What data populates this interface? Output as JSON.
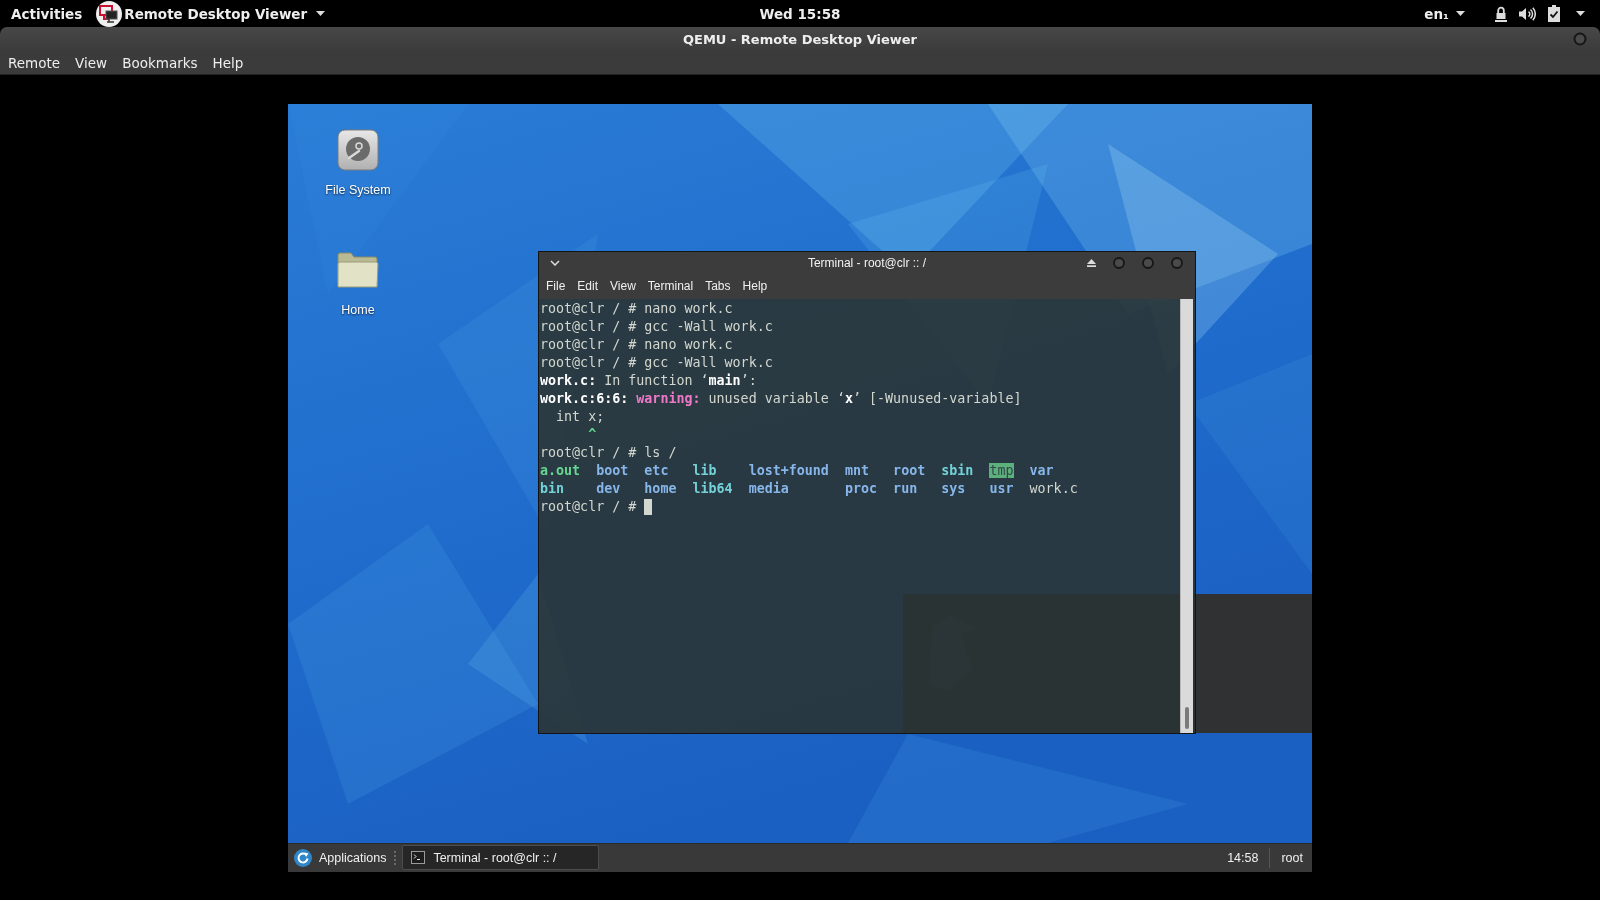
{
  "top_bar": {
    "activities": "Activities",
    "app_menu": "Remote Desktop Viewer",
    "clock": "Wed 15:58",
    "keyboard_layout": "en₁"
  },
  "window": {
    "title": "QEMU - Remote Desktop Viewer",
    "menu": [
      "Remote",
      "View",
      "Bookmarks",
      "Help"
    ]
  },
  "guest": {
    "desktop_icons": [
      {
        "kind": "drive",
        "label": "File System"
      },
      {
        "kind": "folder",
        "label": "Home"
      }
    ],
    "terminal": {
      "title": "Terminal - root@clr :: /",
      "menu": [
        "File",
        "Edit",
        "View",
        "Terminal",
        "Tabs",
        "Help"
      ],
      "lines": [
        {
          "segments": [
            {
              "kind": "plain",
              "text": "root@clr / # nano work.c"
            }
          ]
        },
        {
          "segments": [
            {
              "kind": "plain",
              "text": "root@clr / # gcc -Wall work.c"
            }
          ]
        },
        {
          "segments": [
            {
              "kind": "plain",
              "text": "root@clr / # nano work.c"
            }
          ]
        },
        {
          "segments": [
            {
              "kind": "plain",
              "text": "root@clr / # gcc -Wall work.c"
            }
          ]
        },
        {
          "segments": [
            {
              "kind": "bold",
              "text": "work.c:"
            },
            {
              "kind": "plain",
              "text": " In function ‘"
            },
            {
              "kind": "bold",
              "text": "main"
            },
            {
              "kind": "plain",
              "text": "’:"
            }
          ]
        },
        {
          "segments": [
            {
              "kind": "bold",
              "text": "work.c:6:6:"
            },
            {
              "kind": "warning",
              "text": " warning:"
            },
            {
              "kind": "plain",
              "text": " unused variable ‘"
            },
            {
              "kind": "bold",
              "text": "x"
            },
            {
              "kind": "plain",
              "text": "’ [-Wunused-variable]"
            }
          ]
        },
        {
          "segments": [
            {
              "kind": "plain",
              "text": "  int x;"
            }
          ]
        },
        {
          "segments": [
            {
              "kind": "caret",
              "text": "      ^"
            }
          ]
        },
        {
          "segments": [
            {
              "kind": "plain",
              "text": "root@clr / # ls /"
            }
          ]
        }
      ],
      "listing": [
        [
          {
            "name": "a.out",
            "kind": "executable"
          },
          {
            "name": "boot",
            "kind": "directory"
          },
          {
            "name": "etc",
            "kind": "directory"
          },
          {
            "name": "lib",
            "kind": "symlink"
          },
          {
            "name": "lost+found",
            "kind": "directory"
          },
          {
            "name": "mnt",
            "kind": "directory"
          },
          {
            "name": "root",
            "kind": "directory"
          },
          {
            "name": "sbin",
            "kind": "symlink"
          },
          {
            "name": "tmp",
            "kind": "sticky_directory"
          },
          {
            "name": "var",
            "kind": "directory"
          }
        ],
        [
          {
            "name": "bin",
            "kind": "symlink"
          },
          {
            "name": "dev",
            "kind": "directory"
          },
          {
            "name": "home",
            "kind": "directory"
          },
          {
            "name": "lib64",
            "kind": "symlink"
          },
          {
            "name": "media",
            "kind": "directory"
          },
          {
            "name": "proc",
            "kind": "directory"
          },
          {
            "name": "run",
            "kind": "directory"
          },
          {
            "name": "sys",
            "kind": "directory"
          },
          {
            "name": "usr",
            "kind": "directory"
          },
          {
            "name": "work.c",
            "kind": "file"
          }
        ]
      ],
      "prompt": "root@clr / #",
      "cursor": true
    },
    "taskbar": {
      "menu": "Applications",
      "tasks": [
        {
          "label": "Terminal - root@clr :: /",
          "selected": true
        }
      ],
      "clock": "14:58",
      "user": "root"
    }
  }
}
